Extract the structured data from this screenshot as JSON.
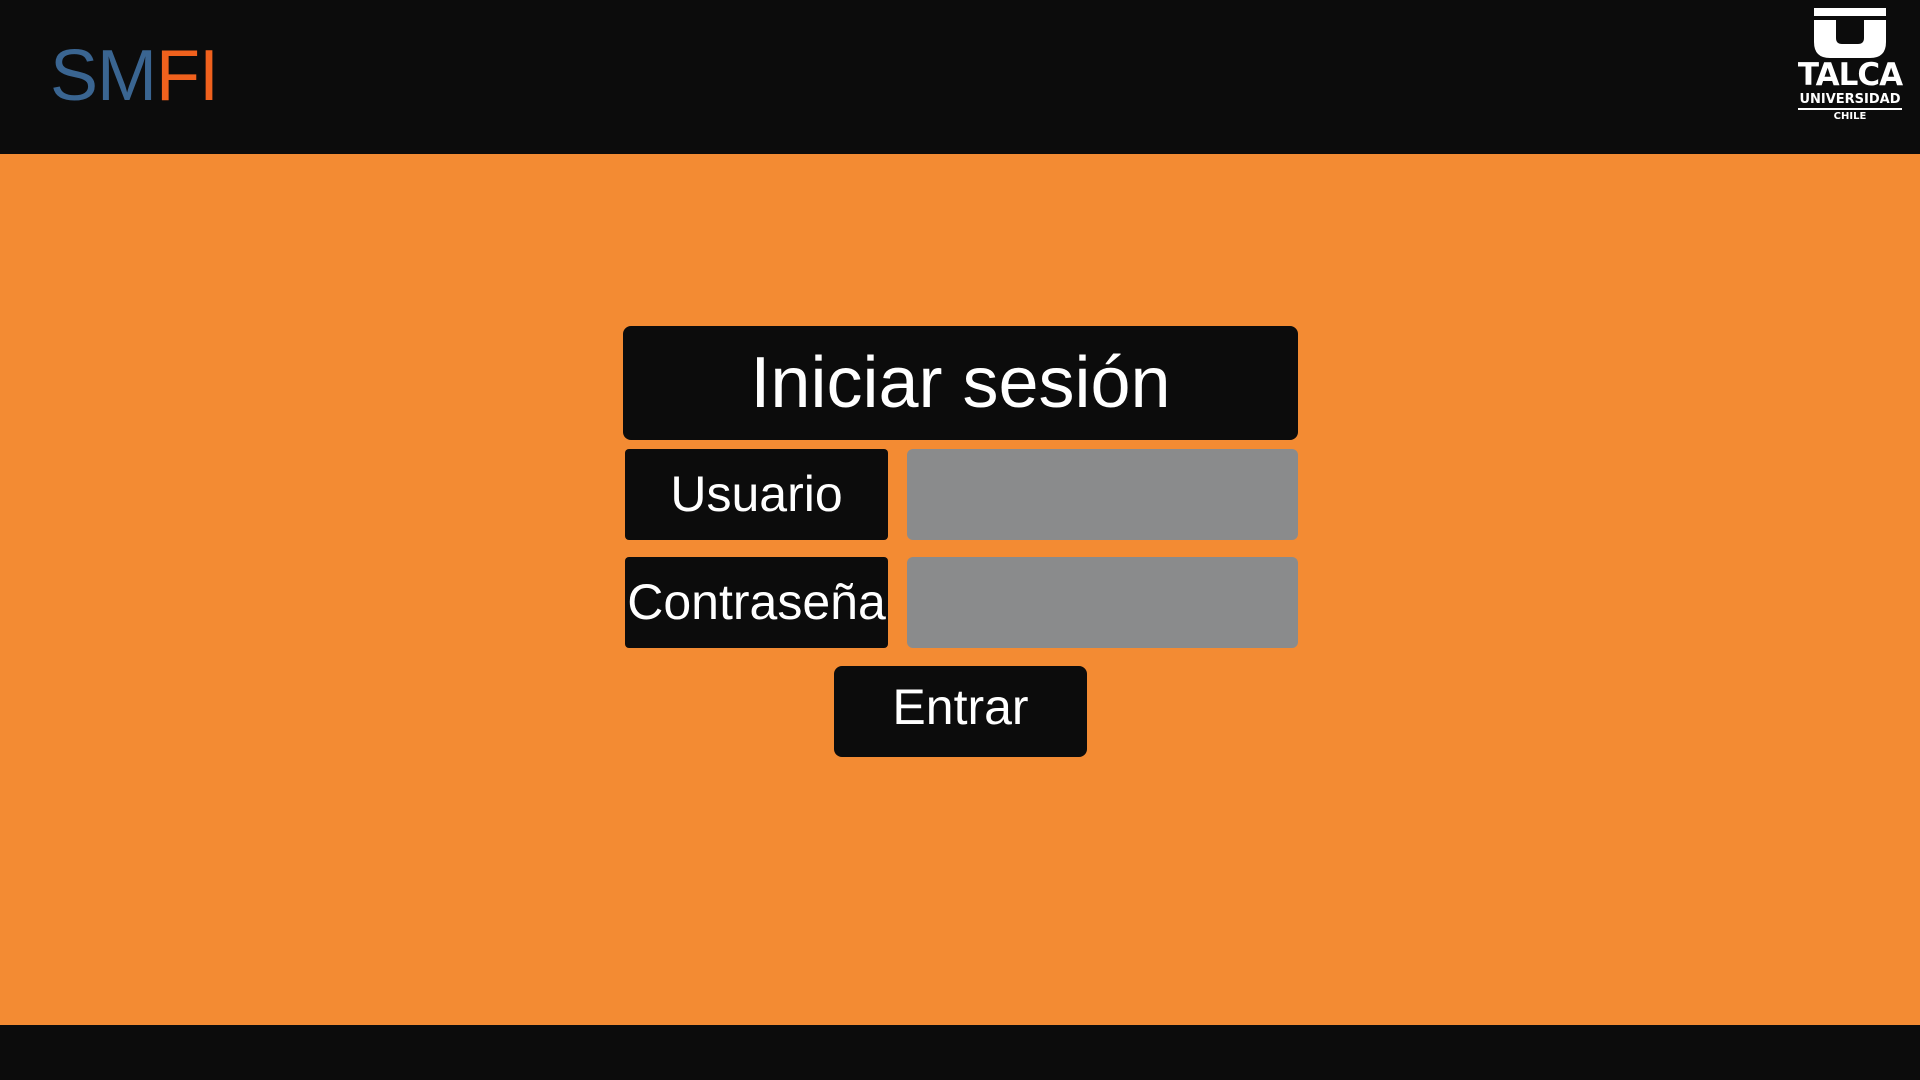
{
  "header": {
    "brand_part1": "SM",
    "brand_part2": "FI",
    "brand_colors": {
      "part1": "#3a6591",
      "part2": "#f0611d"
    },
    "logo": {
      "icon": "university-u-logo-icon",
      "line1": "TALCA",
      "line2": "UNIVERSIDAD",
      "line3": "CHILE"
    }
  },
  "login": {
    "title": "Iniciar sesión",
    "user_label": "Usuario",
    "user_value": "",
    "password_label": "Contraseña",
    "password_value": "",
    "submit_label": "Entrar"
  },
  "colors": {
    "background": "#f38b33",
    "bars": "#0c0c0c",
    "input_fill": "#8a8b8c",
    "text": "#ffffff"
  }
}
